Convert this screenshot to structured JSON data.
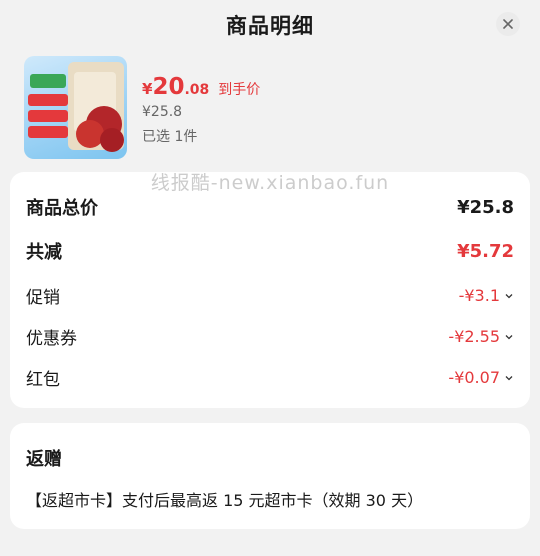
{
  "header": {
    "title": "商品明细"
  },
  "product": {
    "price_currency": "¥",
    "price_int": "20",
    "price_dec": ".08",
    "price_tag": "到手价",
    "original_price": "¥25.8",
    "selected_count": "已选 1件",
    "thumb_lines": [
      "十月稻田",
      "和田红枣",
      "肉厚核小",
      "口感果实",
      "新疆大枣"
    ]
  },
  "watermark": "线报酷-new.xianbao.fun",
  "summary": {
    "total_label": "商品总价",
    "total_value": "¥25.8",
    "reduce_label": "共减",
    "reduce_value": "¥5.72",
    "items": [
      {
        "label": "促销",
        "value": "-¥3.1"
      },
      {
        "label": "优惠券",
        "value": "-¥2.55"
      },
      {
        "label": "红包",
        "value": "-¥0.07"
      }
    ]
  },
  "gift": {
    "title": "返赠",
    "text": "【返超市卡】支付后最高返 15 元超市卡（效期 30 天）"
  },
  "colors": {
    "accent": "#e4393c",
    "background": "#f2f2f2",
    "card": "#ffffff"
  }
}
